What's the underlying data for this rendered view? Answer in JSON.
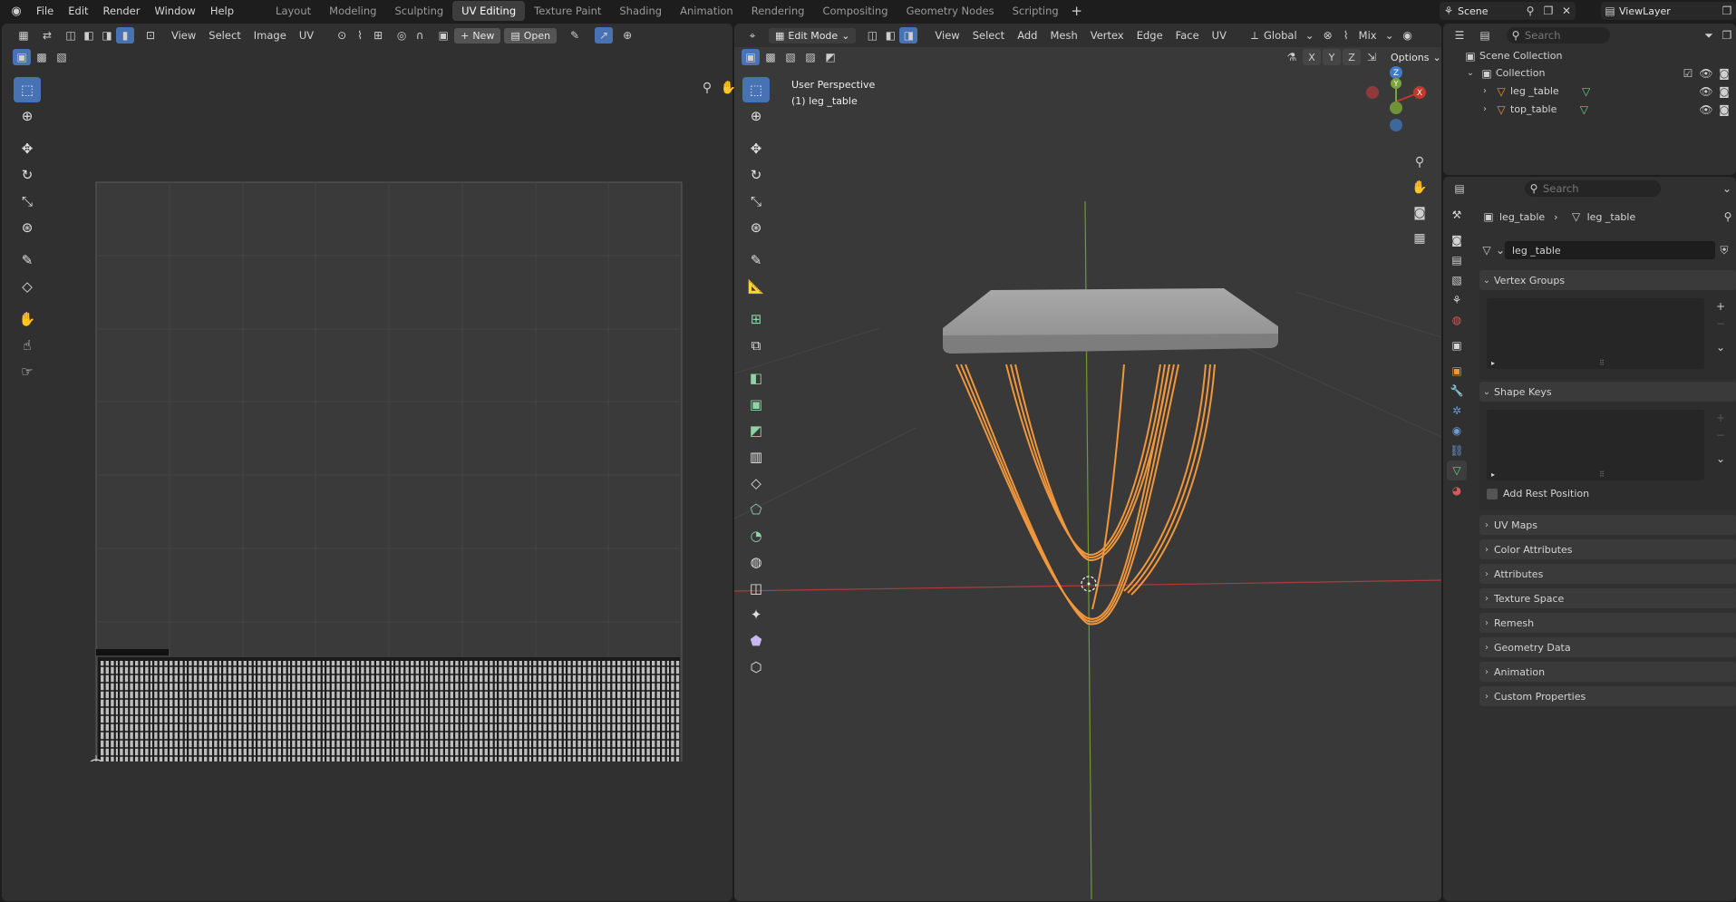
{
  "topbar": {
    "menus": [
      "File",
      "Edit",
      "Render",
      "Window",
      "Help"
    ],
    "workspaces": [
      "Layout",
      "Modeling",
      "Sculpting",
      "UV Editing",
      "Texture Paint",
      "Shading",
      "Animation",
      "Rendering",
      "Compositing",
      "Geometry Nodes",
      "Scripting"
    ],
    "active_workspace": "UV Editing",
    "scene": "Scene",
    "view_layer": "ViewLayer"
  },
  "uv_editor": {
    "menus": [
      "View",
      "Select",
      "Image",
      "UV"
    ],
    "new_label": "New",
    "open_label": "Open"
  },
  "viewport": {
    "mode": "Edit Mode",
    "menus": [
      "View",
      "Select",
      "Add",
      "Mesh",
      "Vertex",
      "Edge",
      "Face",
      "UV"
    ],
    "orientation": "Global",
    "pivot": "Mix",
    "options_label": "Options",
    "axes": [
      "X",
      "Y",
      "Z"
    ],
    "overlay_title": "User Perspective",
    "overlay_object": "(1) leg _table",
    "gizmo_labels": [
      "Z",
      "Y",
      "X"
    ]
  },
  "outliner": {
    "search_placeholder": "Search",
    "scene_collection": "Scene Collection",
    "collection": "Collection",
    "objects": [
      "leg _table",
      "top_table"
    ]
  },
  "properties": {
    "search_placeholder": "Search",
    "breadcrumb_object": "leg_table",
    "breadcrumb_mesh": "leg _table",
    "mesh_name": "leg _table",
    "sections": {
      "vertex_groups": "Vertex Groups",
      "shape_keys": "Shape Keys",
      "add_rest_position": "Add Rest Position",
      "collapsed": [
        "UV Maps",
        "Color Attributes",
        "Attributes",
        "Texture Space",
        "Remesh",
        "Geometry Data",
        "Animation",
        "Custom Properties"
      ]
    }
  },
  "colors": {
    "accent": "#4772b3",
    "orange": "#f0963c",
    "x_axis": "#c0392b",
    "y_axis": "#7aa33a",
    "z_axis": "#3d7cc9"
  }
}
